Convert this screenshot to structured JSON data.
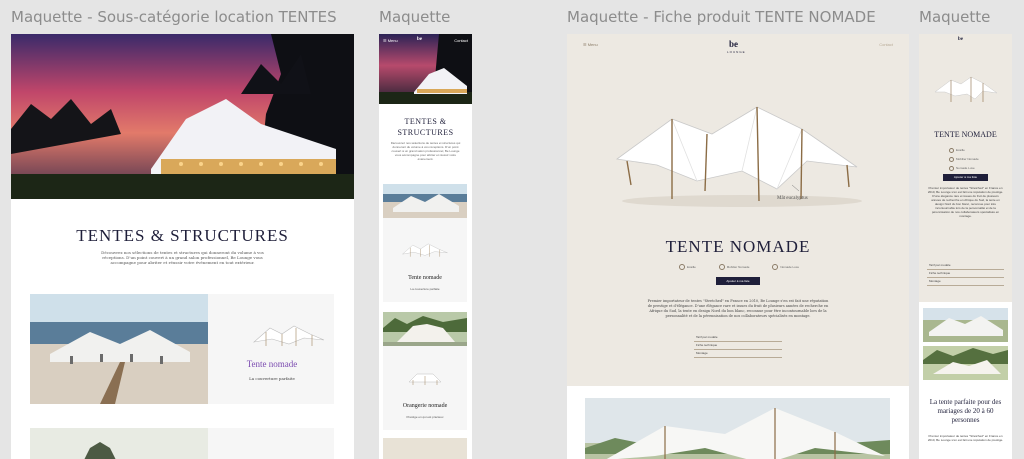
{
  "frames": {
    "f1_label": "Maquette - Sous-catégorie location TENTES",
    "f2_label": "Maquette",
    "f3_label": "Maquette - Fiche produit TENTE NOMADE",
    "f4_label": "Maquette"
  },
  "subcategory_desktop": {
    "title": "TENTES & STRUCTURES",
    "description": "Découvrez nos sélections de tentes et structures qui donneront du volume à vos réceptions. D'un point couvert à un grand salon professionnel, Be Lounge vous accompagne pour abriter et réussir votre événement en tout extérieur.",
    "card_name": "Tente nomade",
    "card_tagline": "La couverture parfaite"
  },
  "subcategory_mobile": {
    "menu": "Menu",
    "logo": "be",
    "contact": "Contact",
    "title": "TENTES & STRUCTURES",
    "description": "Découvrez nos sélections de tentes et structures qui donneront du volume à vos réceptions. D'un point couvert à un grand salon professionnel, Be Lounge vous accompagne pour abriter et réussir votre événement.",
    "card1_name": "Tente nomade",
    "card1_tagline": "La couverture parfaite",
    "card2_name": "Orangerie nomade",
    "card2_tagline": "Prestige en qui est précieux"
  },
  "product_desktop": {
    "menu": "Menu",
    "logo": "be",
    "logo_sub": "LOUNGE",
    "contact": "Contact",
    "dimensions": "Mât eucalyptus",
    "title": "TENTE NOMADE",
    "spec1": "Ecaille",
    "spec2": "Mobilier Nomade",
    "spec3": "Nomade Luxe",
    "cta": "Ajouter à ma liste",
    "description": "Premier importateur de tentes \"Stretched\" en France en 2010, Be Lounge s'en est fait une réputation de prestige et d'élégance. D'une élégance rare et issues du fruit de plusieurs années de recherche en Afrique du Sud, la tente en design Nord du bon blanc, reconnue pour être incontournable lors de la personnalité et de la pérennisation de nos collaborateurs spécialisés en montage.",
    "link1": "Tarif par modèle",
    "link2": "Fiche technique",
    "link3": "Montage"
  },
  "product_mobile": {
    "logo": "be",
    "title": "TENTE NOMADE",
    "spec1": "Ecaille",
    "spec2": "Mobilier Nomade",
    "spec3": "Nomade Luxe",
    "cta": "Ajouter à ma liste",
    "description": "Premier importateur de tentes \"Stretched\" en France en 2010, Be Lounge s'en est fait une réputation de prestige. D'une élégance rare et issues du fruit de plusieurs années de recherche en Afrique du Sud, la tente en design Nord du bon blanc, reconnue pour être incontournable lors de la personnalité et de la pérennisation de nos collaborateurs spécialisés en montage.",
    "link1": "Tarif par modèle",
    "link2": "Fiche technique",
    "link3": "Montage",
    "headline": "La tente parfaite pour des mariages de 20 à 60 personnes",
    "description2": "Premier importateur de tentes \"Stretched\" en France en 2010, Be Lounge s'en est fait une réputation de prestige."
  }
}
